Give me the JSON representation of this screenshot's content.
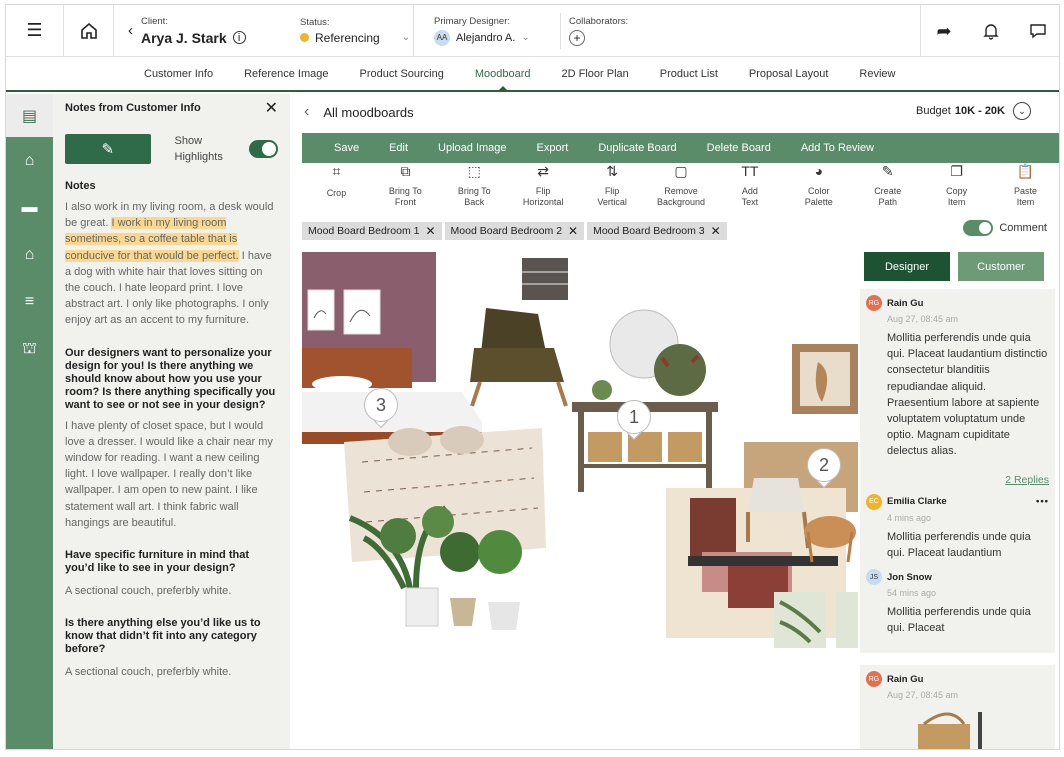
{
  "header": {
    "client_label": "Client:",
    "client_name": "Arya J. Stark",
    "status_label": "Status:",
    "status_value": "Referencing",
    "designer_label": "Primary Designer:",
    "designer_initials": "AA",
    "designer_name": "Alejandro A.",
    "collab_label": "Collaborators:"
  },
  "tabs": [
    "Customer Info",
    "Reference Image",
    "Product Sourcing",
    "Moodboard",
    "2D Floor Plan",
    "Product List",
    "Proposal Layout",
    "Review"
  ],
  "notes": {
    "title": "Notes from Customer Info",
    "show_highlights": "Show Highlights",
    "notes_heading": "Notes",
    "note_pre": "I also work in my living room, a desk would be great. ",
    "note_hl": "I work in my living room sometimes, so a coffee table that is conducive for that would be perfect.",
    "note_post": " I have a dog with white hair that loves sitting on the couch. I hate leopard print. I love abstract art. I only like photographs. I only enjoy art as an accent to my furniture.",
    "q1": "Our designers want to personalize your design for you! Is there anything we should know about how you use your room? Is there anything specifically you want to see or not see in your design?",
    "a1": "I have plenty of closet space, but I would love a dresser. I would like a chair near my window for reading. I want a new ceiling light. I love wallpaper. I really don’t like wallpaper. I am open to new paint. I like statement wall art. I think fabric wall hangings are beautiful.",
    "q2": "Have specific furniture in mind that you’d like to see in your design?",
    "a2": "A sectional couch, preferbly white.",
    "q3": "Is there anything else you’d like us to know that didn’t fit into any category before?",
    "a3": "A sectional couch, preferbly white."
  },
  "main": {
    "title": "All moodboards",
    "budget_label": "Budget",
    "budget_value": "10K - 20K",
    "actions": [
      "Save",
      "Edit",
      "Upload Image",
      "Export",
      "Duplicate Board",
      "Delete Board",
      "Add To Review"
    ],
    "tools": [
      {
        "icon": "crop-icon",
        "glyph": "⌗",
        "l1": "Crop",
        "l2": ""
      },
      {
        "icon": "bring-front-icon",
        "glyph": "⧉",
        "l1": "Bring To",
        "l2": "Front"
      },
      {
        "icon": "bring-back-icon",
        "glyph": "⬚",
        "l1": "Bring To",
        "l2": "Back"
      },
      {
        "icon": "flip-h-icon",
        "glyph": "⇄",
        "l1": "Flip",
        "l2": "Horizontal"
      },
      {
        "icon": "flip-v-icon",
        "glyph": "⇅",
        "l1": "Flip",
        "l2": "Vertical"
      },
      {
        "icon": "remove-bg-icon",
        "glyph": "▢",
        "l1": "Remove",
        "l2": "Background"
      },
      {
        "icon": "add-text-icon",
        "glyph": "TT",
        "l1": "Add",
        "l2": "Text"
      },
      {
        "icon": "palette-icon",
        "glyph": "◕",
        "l1": "Color",
        "l2": "Palette"
      },
      {
        "icon": "pen-icon",
        "glyph": "✎",
        "l1": "Create",
        "l2": "Path"
      },
      {
        "icon": "copy-icon",
        "glyph": "❐",
        "l1": "Copy",
        "l2": "Item"
      },
      {
        "icon": "paste-icon",
        "glyph": "📋",
        "l1": "Paste",
        "l2": "Item"
      }
    ],
    "boards": [
      "Mood Board Bedroom 1",
      "Mood Board Bedroom 2",
      "Mood Board Bedroom 3"
    ],
    "comment_label": "Comment",
    "pins": [
      "1",
      "2",
      "3"
    ]
  },
  "comments": {
    "designer_btn": "Designer",
    "customer_btn": "Customer",
    "c1_initials": "RG",
    "c1_name": "Rain Gu",
    "c1_time": "Aug 27, 08:45 am",
    "c1_text": "Mollitia perferendis unde quia qui. Placeat laudantium distinctio consectetur blanditiis repudiandae aliquid. Praesentium labore at sapiente voluptatem voluptatum unde optio. Magnam cupiditate delectus alias.",
    "replies": "2 Replies",
    "c2_initials": "EC",
    "c2_name": "Emilia Clarke",
    "c2_time": "4 mins ago",
    "c2_text": "Mollitia perferendis unde quia qui. Placeat laudantium",
    "c3_initials": "JS",
    "c3_name": "Jon Snow",
    "c3_time": "54 mins ago",
    "c3_text": "Mollitia perferendis unde quia qui. Placeat",
    "c4_initials": "RG",
    "c4_name": "Rain Gu",
    "c4_time": "Aug 27, 08:45 am"
  }
}
